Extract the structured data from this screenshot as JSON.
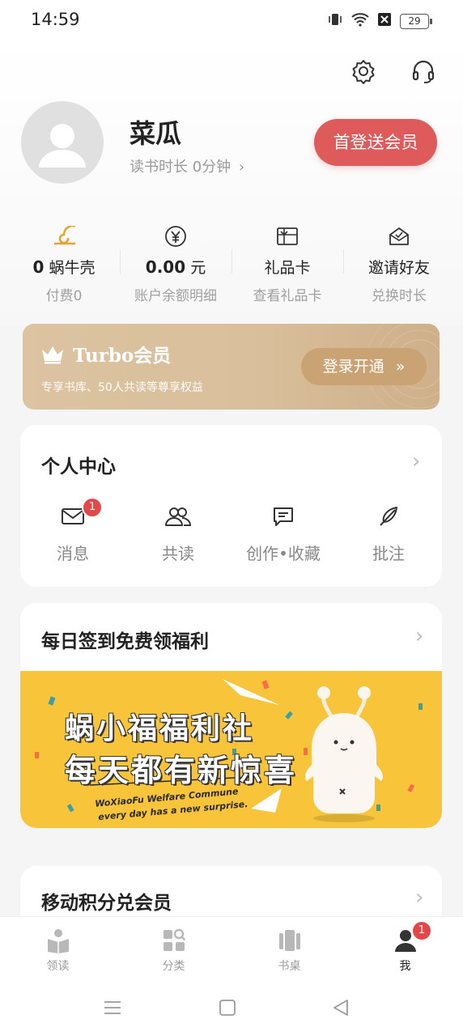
{
  "status_bar": {
    "time": "14:59",
    "battery": "29"
  },
  "profile": {
    "username": "菜瓜",
    "reading_time": "读书时长 0分钟",
    "promo_button": "首登送会员"
  },
  "stats": [
    {
      "icon": "snail-shell-icon",
      "value_num": "0",
      "value_unit": "蜗牛壳",
      "sub": "付费0"
    },
    {
      "icon": "yen-icon",
      "value_num": "0.00",
      "value_unit": "元",
      "sub": "账户余额明细"
    },
    {
      "icon": "gift-card-icon",
      "value_num": "",
      "value_unit": "礼品卡",
      "sub": "查看礼品卡"
    },
    {
      "icon": "invite-envelope-icon",
      "value_num": "",
      "value_unit": "邀请好友",
      "sub": "兑换时长"
    }
  ],
  "turbo": {
    "title": "Turbo会员",
    "subtitle": "专享书库、50人共读等尊享权益",
    "button": "登录开通",
    "button_arrow": "»"
  },
  "personal_center": {
    "title": "个人中心",
    "items": [
      {
        "label": "消息",
        "badge": "1"
      },
      {
        "label": "共读"
      },
      {
        "label": "创作•收藏"
      },
      {
        "label": "批注"
      }
    ]
  },
  "checkin": {
    "title": "每日签到免费领福利",
    "banner_line1": "蜗小福福利社",
    "banner_line2": "每天都有新惊喜",
    "banner_en1": "WoXiaoFu Welfare Commune",
    "banner_en2": "every day has a new surprise."
  },
  "points": {
    "title": "移动积分兑会员"
  },
  "bottom_nav": [
    {
      "label": "领读"
    },
    {
      "label": "分类"
    },
    {
      "label": "书桌"
    },
    {
      "label": "我",
      "badge": "1",
      "active": true
    }
  ],
  "colors": {
    "accent_red": "#df5a5a",
    "turbo_gold": "#d9bf9b",
    "banner_yellow": "#f8c53a"
  }
}
